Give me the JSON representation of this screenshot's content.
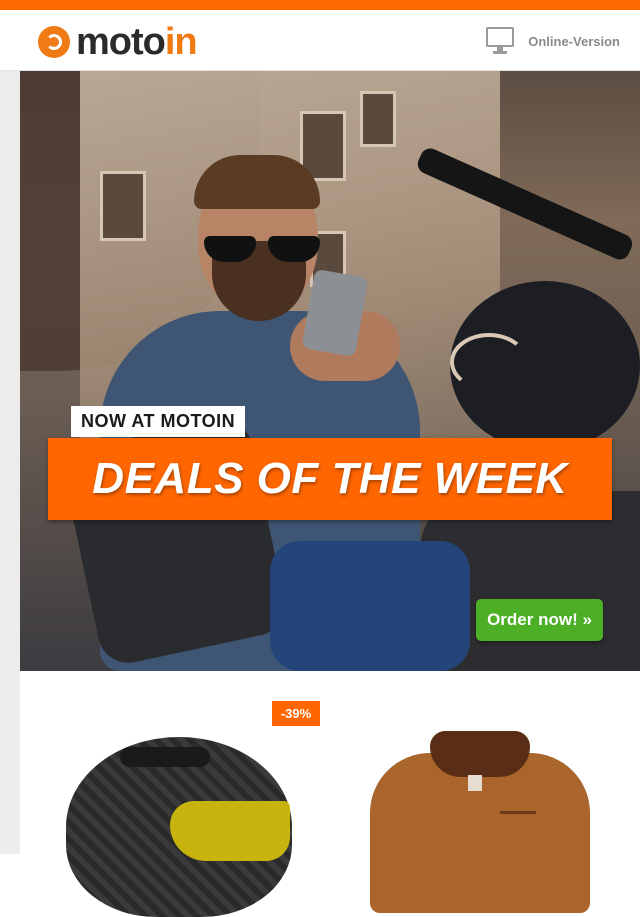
{
  "header": {
    "logo": {
      "part1": "moto",
      "part2": "in"
    },
    "online_version_label": "Online-Version",
    "online_version_icon": "monitor-icon"
  },
  "hero": {
    "tag": "NOW AT MOTOIN",
    "headline": "DEALS OF THE WEEK",
    "cta_label": "Order now! »"
  },
  "products": {
    "items": [
      {
        "badge": "-39%",
        "image": "carbon-helmet-image"
      },
      {
        "image": "brown-jacket-image"
      }
    ]
  },
  "colors": {
    "accent": "#ff6a00",
    "cta": "#4caf26",
    "logo_dark": "#2b2b2b"
  }
}
